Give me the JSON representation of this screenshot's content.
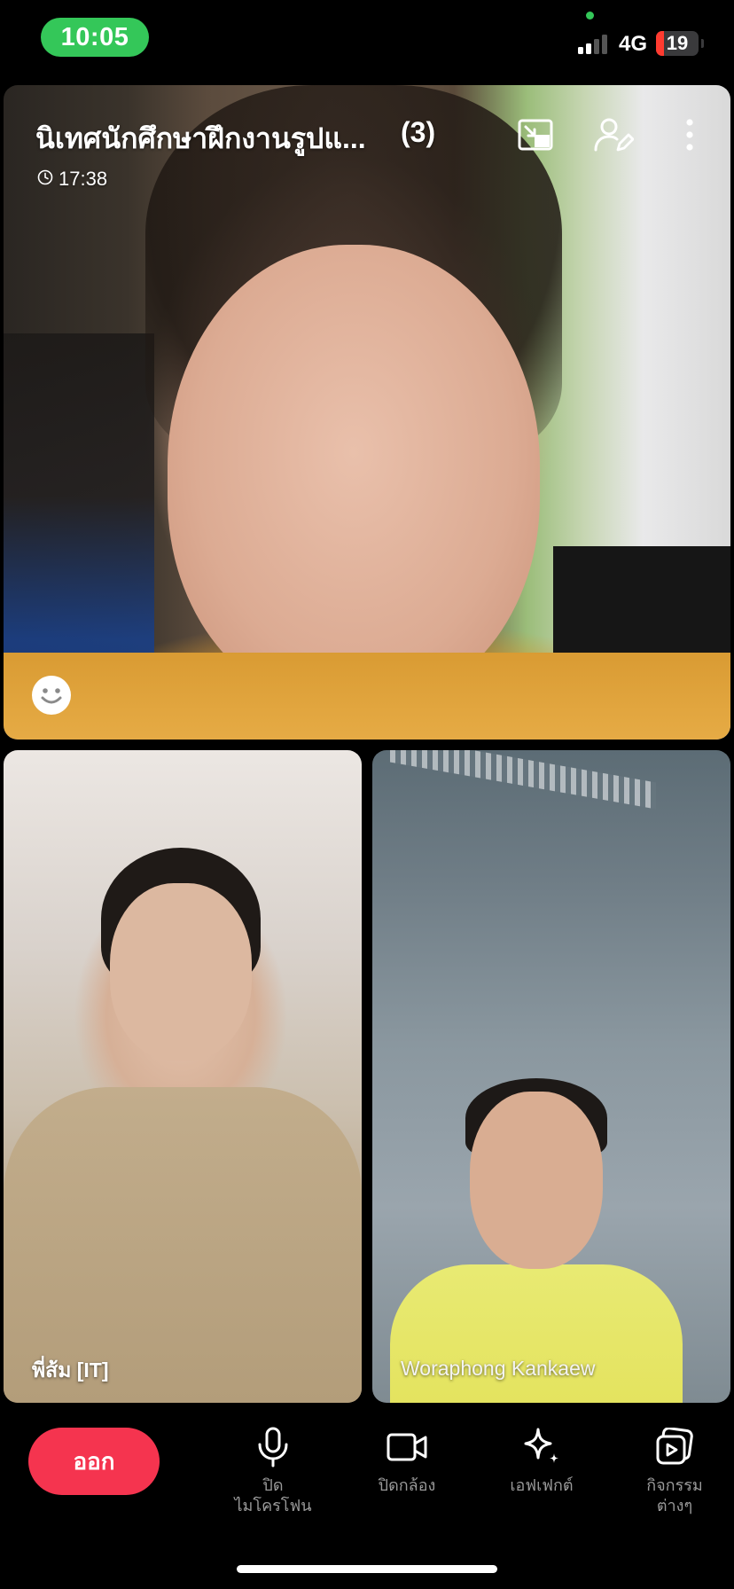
{
  "status_bar": {
    "time": "10:05",
    "network": "4G",
    "battery_level": "19",
    "battery_fraction": 0.19,
    "colors": {
      "time_pill": "#34c759",
      "battery_low": "#ff3b30"
    }
  },
  "call": {
    "title": "นิเทศนักศึกษาฝึกงานรูปแ...",
    "participant_count": "(3)",
    "duration": "17:38",
    "header_icons": [
      "pip-icon",
      "participants-edit-icon",
      "more-vertical-icon"
    ],
    "reaction_icon": "smiley-icon"
  },
  "tiles": [
    {
      "name": ""
    },
    {
      "name": "พี่ส้ม [IT]"
    },
    {
      "name": "Woraphong Kankaew"
    }
  ],
  "toolbar": {
    "leave_label": "ออก",
    "leave_color": "#f5344f",
    "tools": [
      {
        "icon": "microphone-icon",
        "label_line1": "ปิด",
        "label_line2": "ไมโครโฟน"
      },
      {
        "icon": "camera-icon",
        "label_line1": "ปิดกล้อง",
        "label_line2": ""
      },
      {
        "icon": "sparkle-icon",
        "label_line1": "เอฟเฟกต์",
        "label_line2": ""
      },
      {
        "icon": "activities-icon",
        "label_line1": "กิจกรรม",
        "label_line2": "ต่างๆ"
      }
    ]
  }
}
